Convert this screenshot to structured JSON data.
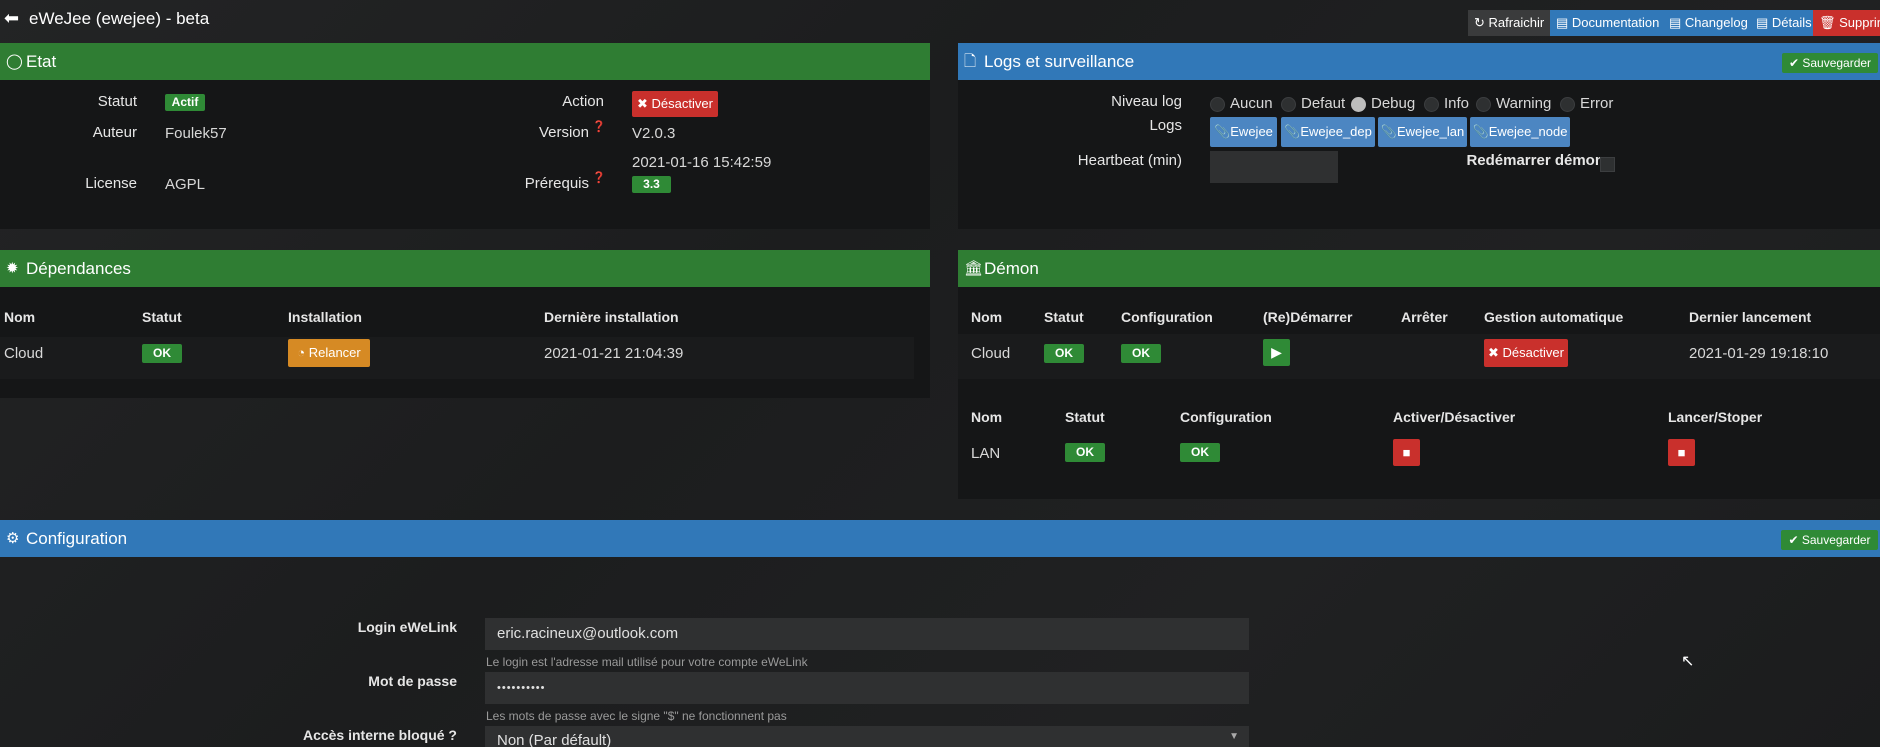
{
  "page": {
    "title": "eWeJee (ewejee) - beta"
  },
  "toolbar": {
    "refresh": "Rafraichir",
    "documentation": "Documentation",
    "changelog": "Changelog",
    "details": "Détails",
    "delete": "Supprimer"
  },
  "etat": {
    "title": "Etat",
    "statut_label": "Statut",
    "statut_value": "Actif",
    "action_label": "Action",
    "action_button": "Désactiver",
    "auteur_label": "Auteur",
    "auteur_value": "Foulek57",
    "version_label": "Version",
    "version_value": "V2.0.3",
    "version_date": "2021-01-16 15:42:59",
    "license_label": "License",
    "license_value": "AGPL",
    "prerequis_label": "Prérequis",
    "prerequis_value": "3.3"
  },
  "logs": {
    "title": "Logs et surveillance",
    "save": "Sauvegarder",
    "niveau_label": "Niveau log",
    "levels": [
      "Aucun",
      "Defaut",
      "Debug",
      "Info",
      "Warning",
      "Error"
    ],
    "selected_level": "Debug",
    "logs_label": "Logs",
    "log_buttons": [
      "Ewejee",
      "Ewejee_dep",
      "Ewejee_lan",
      "Ewejee_node"
    ],
    "heartbeat_label": "Heartbeat (min)",
    "heartbeat_value": "",
    "restart_label": "Redémarrer démon"
  },
  "dependances": {
    "title": "Dépendances",
    "headers": [
      "Nom",
      "Statut",
      "Installation",
      "Dernière installation"
    ],
    "row": {
      "nom": "Cloud",
      "statut": "OK",
      "installation": "Relancer",
      "derniere": "2021-01-21 21:04:39"
    }
  },
  "demon": {
    "title": "Démon",
    "headers": [
      "Nom",
      "Statut",
      "Configuration",
      "(Re)Démarrer",
      "Arrêter",
      "Gestion automatique",
      "Dernier lancement"
    ],
    "row": {
      "nom": "Cloud",
      "statut": "OK",
      "configuration": "OK",
      "gestion": "Désactiver",
      "dernier": "2021-01-29 19:18:10"
    },
    "headers2": [
      "Nom",
      "Statut",
      "Configuration",
      "Activer/Désactiver",
      "Lancer/Stoper"
    ],
    "row2": {
      "nom": "LAN",
      "statut": "OK",
      "configuration": "OK"
    }
  },
  "configuration": {
    "title": "Configuration",
    "save": "Sauvegarder",
    "login_label": "Login eWeLink",
    "login_value": "eric.racineux@outlook.com",
    "login_help": "Le login est l'adresse mail utilisé pour votre compte eWeLink",
    "password_label": "Mot de passe",
    "password_value": "••••••••••",
    "password_help": "Les mots de passe avec le signe \"$\" ne fonctionnent pas",
    "acces_label": "Accès interne bloqué ?",
    "acces_value": "Non (Par défault)"
  },
  "colors": {
    "green_header": "#2f7d33",
    "blue_header": "#3178b8",
    "ok_green": "#2f8a36",
    "danger_red": "#c9302c",
    "warning_orange": "#d68a24",
    "log_blue": "#4c86c2"
  }
}
